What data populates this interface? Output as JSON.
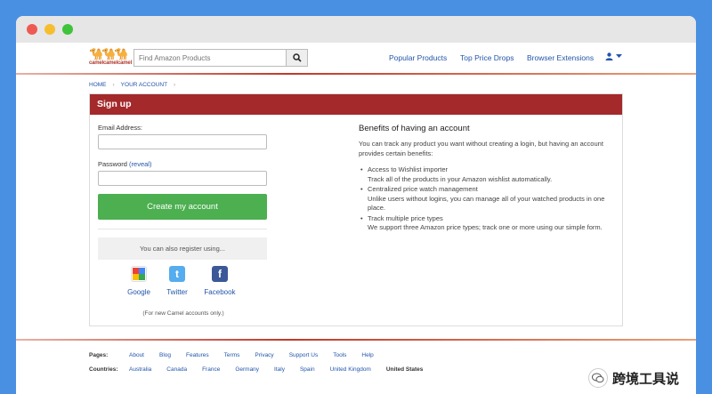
{
  "header": {
    "logo_text": "camelcamelcamel",
    "search_placeholder": "Find Amazon Products",
    "nav": [
      "Popular Products",
      "Top Price Drops",
      "Browser Extensions"
    ]
  },
  "breadcrumb": [
    "HOME",
    "YOUR ACCOUNT"
  ],
  "panel": {
    "title": "Sign up",
    "email_label": "Email Address:",
    "password_label": "Password",
    "reveal": "(reveal)",
    "create_button": "Create my account",
    "also_register": "You can also register using...",
    "social": [
      {
        "label": "Google",
        "color": "#4285f4"
      },
      {
        "label": "Twitter",
        "color": "#55acee"
      },
      {
        "label": "Facebook",
        "color": "#3b5998"
      }
    ],
    "note": "(For new Camel accounts only.)"
  },
  "benefits": {
    "title": "Benefits of having an account",
    "intro": "You can track any product you want without creating a login, but having an account provides certain benefits:",
    "items": [
      {
        "title": "Access to Wishlist importer",
        "desc": "Track all of the products in your Amazon wishlist automatically."
      },
      {
        "title": "Centralized price watch management",
        "desc": "Unlike users without logins, you can manage all of your watched products in one place."
      },
      {
        "title": "Track multiple price types",
        "desc": "We support three Amazon price types; track one or more using our simple form."
      }
    ]
  },
  "footer": {
    "pages_label": "Pages:",
    "pages": [
      "About",
      "Blog",
      "Features",
      "Terms",
      "Privacy",
      "Support Us",
      "Tools",
      "Help"
    ],
    "countries_label": "Countries:",
    "countries": [
      "Australia",
      "Canada",
      "France",
      "Germany",
      "Italy",
      "Spain",
      "United Kingdom",
      "United States"
    ],
    "active_country": "United States"
  },
  "watermark": "跨境工具说",
  "colors": {
    "accent": "#a4292b",
    "button": "#4caf50",
    "link": "#2255aa"
  }
}
